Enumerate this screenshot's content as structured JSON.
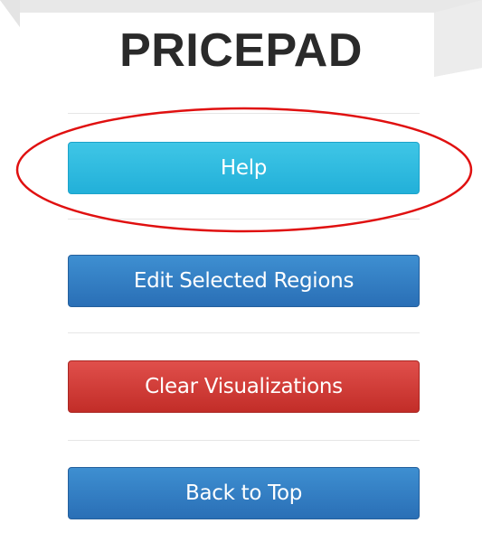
{
  "app": {
    "title": "PRICEPAD"
  },
  "menu": {
    "help_label": "Help",
    "edit_label": "Edit Selected Regions",
    "clear_label": "Clear Visualizations",
    "back_label": "Back to Top"
  },
  "colors": {
    "help": "#2bb8dd",
    "edit": "#3380c4",
    "clear": "#d13a36",
    "back": "#3380c4",
    "highlight_outline": "#e01010"
  }
}
